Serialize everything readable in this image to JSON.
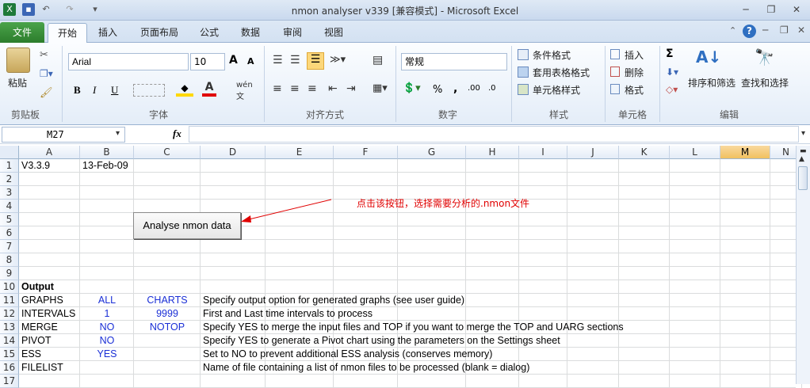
{
  "window": {
    "title": "nmon analyser v339  [兼容模式]  -  Microsoft Excel"
  },
  "tabs": [
    "文件",
    "开始",
    "插入",
    "页面布局",
    "公式",
    "数据",
    "审阅",
    "视图"
  ],
  "ribbon": {
    "clipboard": {
      "paste": "粘贴",
      "label": "剪贴板"
    },
    "font": {
      "name": "Arial",
      "size": "10",
      "label": "字体",
      "bold": "B",
      "italic": "I",
      "underline": "U",
      "grow": "A",
      "shrink": "A"
    },
    "align": {
      "label": "对齐方式"
    },
    "number": {
      "format": "常规",
      "label": "数字",
      "percent": "%",
      "comma": ","
    },
    "styles": {
      "cond": "条件格式",
      "table": "套用表格格式",
      "cell": "单元格样式",
      "label": "样式"
    },
    "cells": {
      "insert": "插入",
      "delete": "删除",
      "format": "格式",
      "label": "单元格"
    },
    "editing": {
      "sum": "Σ",
      "sort": "排序和筛选",
      "find": "查找和选择",
      "label": "编辑"
    }
  },
  "formula_bar": {
    "cell": "M27",
    "fx": "fx",
    "value": ""
  },
  "columns": [
    "A",
    "B",
    "C",
    "D",
    "E",
    "F",
    "G",
    "H",
    "I",
    "J",
    "K",
    "L",
    "M",
    "N"
  ],
  "rows": [
    "1",
    "2",
    "3",
    "4",
    "5",
    "6",
    "7",
    "8",
    "9",
    "10",
    "11",
    "12",
    "13",
    "14",
    "15",
    "16",
    "17"
  ],
  "cells": {
    "A1": "V3.3.9",
    "B1": "13-Feb-09",
    "A10": "Output",
    "A11": "GRAPHS",
    "B11": "ALL",
    "C11": "CHARTS",
    "D11": "Specify output option for generated graphs (see user guide)",
    "A12": "INTERVALS",
    "B12": "1",
    "C12": "9999",
    "D12": "First and Last time intervals to process",
    "A13": "MERGE",
    "B13": "NO",
    "C13": "NOTOP",
    "D13": "Specify YES to merge the input files and TOP if you want to merge the TOP and UARG sections",
    "A14": "PIVOT",
    "B14": "NO",
    "D14": "Specify YES to generate a Pivot chart using the parameters on the Settings sheet",
    "A15": "ESS",
    "B15": "YES",
    "D15": "Set to NO to prevent additional ESS analysis (conserves memory)",
    "A16": "FILELIST",
    "D16": "Name of file containing a list of nmon files to be processed (blank = dialog)"
  },
  "analyse_button": "Analyse nmon data",
  "annotation": "点击该按钮，选择需要分析的.nmon文件",
  "colors": {
    "annotation": "#e00000",
    "accent": "#1a2fd6",
    "selected_col": "#f1c15f"
  }
}
